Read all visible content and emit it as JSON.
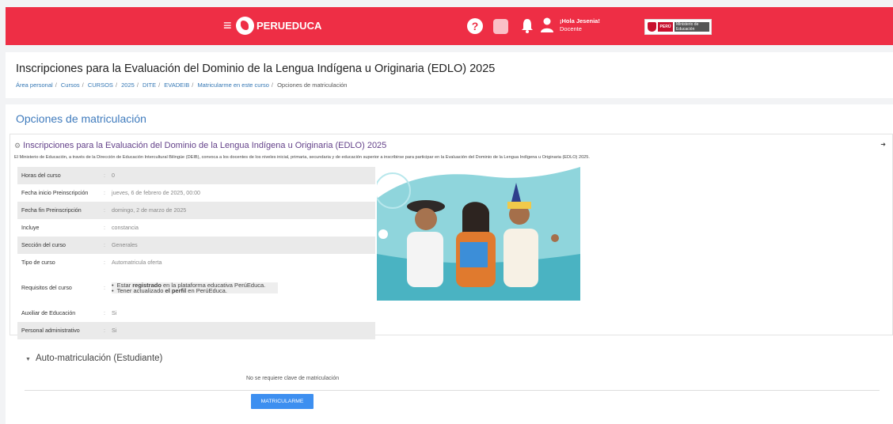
{
  "topbar": {
    "brand": "PERUEDUCA",
    "help_symbol": "?",
    "greeting": "¡Hola Jesenia!",
    "role": "Docente",
    "menu_icon": "hamburger-icon",
    "apps_icon": "apps-grid-icon",
    "bell_icon": "bell-icon",
    "user_icon": "user-icon",
    "minedu": {
      "peru": "PERÚ",
      "ministry": "Ministerio de Educación"
    },
    "colors": {
      "primary": "#ee2e45"
    }
  },
  "header": {
    "title": "Inscripciones para la Evaluación del Dominio de la Lengua Indígena u Originaria (EDLO) 2025",
    "breadcrumb": [
      "Área personal",
      "Cursos",
      "CURSOS",
      "2025",
      "DITE",
      "EVADEIB",
      "Matricularme en este curso",
      "Opciones de matriculación"
    ]
  },
  "main": {
    "section_title": "Opciones de matriculación",
    "course_title": "Inscripciones para la Evaluación del Dominio de la Lengua Indígena u Originaria (EDLO) 2025",
    "summary": "El Ministerio de Educación, a través de la Dirección de Educación Intercultural Bilingüe (DEIB), convoca a los docentes de los niveles inicial, primaria, secundaria y de educación superior a inscribirse para participar en la Evaluación del Dominio de la Lengua Indígena u Originaria (EDLO) 2025.",
    "details": [
      {
        "key": "Horas del curso",
        "value": "0"
      },
      {
        "key": "Fecha inicio Preinscripción",
        "value": "jueves, 6 de febrero de 2025, 00:00"
      },
      {
        "key": "Fecha fin Preinscripción",
        "value": "domingo, 2 de marzo de 2025"
      },
      {
        "key": "Incluye",
        "value": "constancia"
      },
      {
        "key": "Sección del curso",
        "value": "Generales"
      },
      {
        "key": "Tipo de curso",
        "value": "Automatricula oferta"
      },
      {
        "key": "Requisitos del curso",
        "value": ""
      },
      {
        "key": "Auxiliar de Educación",
        "value": "Si"
      },
      {
        "key": "Personal administrativo",
        "value": "Si"
      }
    ],
    "requirements": [
      {
        "before": "Estar ",
        "bold": "registrado",
        "after": " en la plataforma educativa PerúEduca."
      },
      {
        "before": "Tener actualizado ",
        "bold": "el perfil",
        "after": " en PerúEduca."
      }
    ],
    "self_enrol_title": "Auto-matriculación (Estudiante)",
    "no_key": "No se requiere clave de matriculación",
    "enrol_button": "MATRICULARME"
  }
}
